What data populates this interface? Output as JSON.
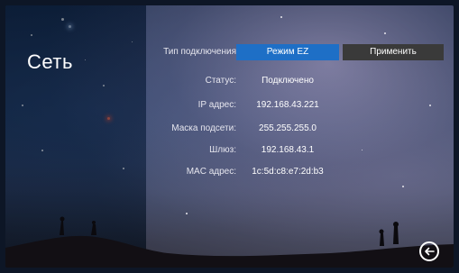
{
  "screen": {
    "title": "Сеть"
  },
  "connection": {
    "type_label": "Тип подключения",
    "mode_button": "Режим EZ",
    "apply_button": "Применить"
  },
  "rows": [
    {
      "label": "Статус:",
      "value": "Подключено"
    },
    {
      "label": "IP адрес:",
      "value": "192.168.43.221"
    },
    {
      "label": "Маска подсети:",
      "value": "255.255.255.0"
    },
    {
      "label": "Шлюз:",
      "value": "192.168.43.1"
    },
    {
      "label": "MAC адрес:",
      "value": "1c:5d:c8:e7:2d:b3"
    }
  ],
  "icons": {
    "back": "back-arrow-circle-icon"
  },
  "colors": {
    "accent": "#1e6fc6",
    "apply_bg": "#3a3a3a",
    "text": "#ffffff"
  }
}
